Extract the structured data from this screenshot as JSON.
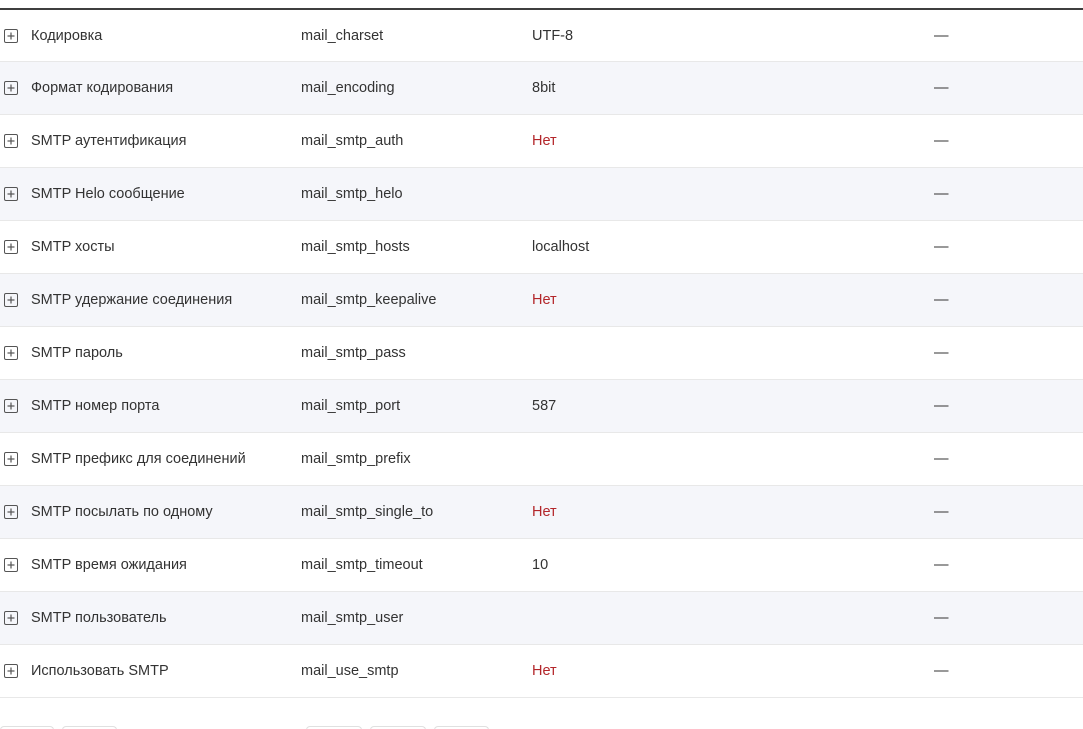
{
  "settings_table": {
    "rows": [
      {
        "title": "Кодировка",
        "key": "mail_charset",
        "value": "UTF-8",
        "value_is_negative": false,
        "extra": "—"
      },
      {
        "title": "Формат кодирования",
        "key": "mail_encoding",
        "value": "8bit",
        "value_is_negative": false,
        "extra": "—"
      },
      {
        "title": "SMTP аутентификация",
        "key": "mail_smtp_auth",
        "value": "Нет",
        "value_is_negative": true,
        "extra": "—"
      },
      {
        "title": "SMTP Helo сообщение",
        "key": "mail_smtp_helo",
        "value": "",
        "value_is_negative": false,
        "extra": "—"
      },
      {
        "title": "SMTP хосты",
        "key": "mail_smtp_hosts",
        "value": "localhost",
        "value_is_negative": false,
        "extra": "—"
      },
      {
        "title": "SMTP удержание соединения",
        "key": "mail_smtp_keepalive",
        "value": "Нет",
        "value_is_negative": true,
        "extra": "—"
      },
      {
        "title": "SMTP пароль",
        "key": "mail_smtp_pass",
        "value": "",
        "value_is_negative": false,
        "extra": "—"
      },
      {
        "title": "SMTP номер порта",
        "key": "mail_smtp_port",
        "value": "587",
        "value_is_negative": false,
        "extra": "—"
      },
      {
        "title": "SMTP префикс для соединений",
        "key": "mail_smtp_prefix",
        "value": "",
        "value_is_negative": false,
        "extra": "—"
      },
      {
        "title": "SMTP посылать по одному",
        "key": "mail_smtp_single_to",
        "value": "Нет",
        "value_is_negative": true,
        "extra": "—"
      },
      {
        "title": "SMTP время ожидания",
        "key": "mail_smtp_timeout",
        "value": "10",
        "value_is_negative": false,
        "extra": "—"
      },
      {
        "title": "SMTP пользователь",
        "key": "mail_smtp_user",
        "value": "",
        "value_is_negative": false,
        "extra": "—"
      },
      {
        "title": "Использовать SMTP",
        "key": "mail_use_smtp",
        "value": "Нет",
        "value_is_negative": true,
        "extra": "—"
      }
    ]
  },
  "icons": {
    "expand": "plus-square-icon"
  },
  "colors": {
    "negative_value": "#b3262a",
    "row_alt_background": "#f5f6fa",
    "text": "#333333"
  }
}
